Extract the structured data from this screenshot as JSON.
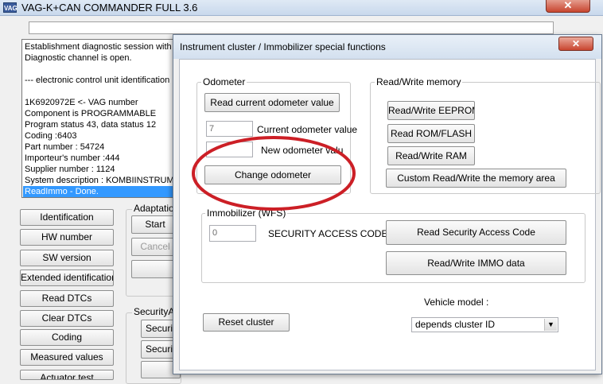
{
  "main_window": {
    "icon_text": "VAG",
    "title": "VAG-K+CAN COMMANDER FULL 3.6",
    "close_symbol": "✕",
    "log_lines": [
      "Establishment diagnostic session with",
      "Diagnostic channel is open.",
      "",
      "  --- electronic control unit identification",
      "",
      "1K6920972E   <- VAG number",
      "Component is PROGRAMMABLE",
      "Program status 43, data status 12",
      "Coding :6403",
      "Part number : 54724",
      "Importeur's number :444",
      "Supplier number : 1124",
      "System description : KOMBIINSTRUMENT",
      "ReadImmo - Done."
    ],
    "side_buttons": [
      "Identification",
      "HW number",
      "SW version",
      "Extended identification",
      "Read DTCs",
      "Clear DTCs",
      "Coding",
      "Measured values",
      "Actuator test"
    ],
    "adaptation": {
      "group_label": "Adaptation",
      "start": "Start",
      "cancel": "Cancel"
    },
    "security": {
      "group_label": "SecurityAc",
      "button1": "Securit",
      "button2": "Securit"
    }
  },
  "dialog": {
    "title": "Instrument cluster / Immobilizer special functions",
    "close_symbol": "✕",
    "odometer": {
      "group_label": "Odometer",
      "read_button": "Read current odometer value",
      "current_value": "7",
      "current_label": "Current odometer value",
      "new_value": "",
      "new_label": "New odometer value",
      "change_button": "Change odometer"
    },
    "memory": {
      "group_label": "Read/Write memory",
      "eeprom": "Read/Write EEPROM",
      "rom_flash": "Read ROM/FLASH",
      "ram": "Read/Write RAM",
      "custom": "Custom Read/Write the memory area"
    },
    "immobilizer": {
      "group_label": "Immobilizer (WFS)",
      "code_value": "0",
      "code_label": "SECURITY ACCESS CODE",
      "read_code_button": "Read Security Access Code",
      "immo_data_button": "Read/Write IMMO data"
    },
    "reset_button": "Reset cluster",
    "vehicle_model_label": "Vehicle model :",
    "vehicle_model_selected": "depends cluster ID",
    "dropdown_arrow": "▼"
  },
  "colors": {
    "highlight_ellipse": "#cc1f26",
    "selection": "#3399ff"
  }
}
